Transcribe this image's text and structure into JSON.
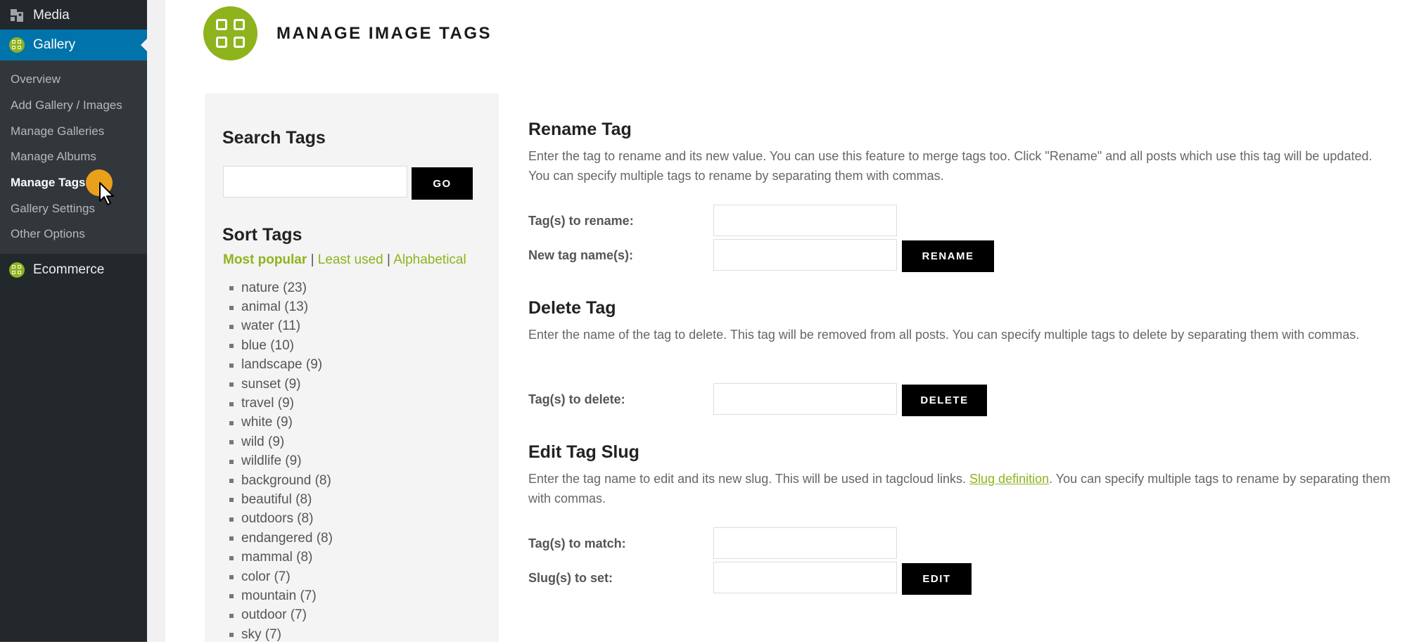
{
  "sidebar": {
    "media_label": "Media",
    "gallery_label": "Gallery",
    "submenu": [
      {
        "label": "Overview"
      },
      {
        "label": "Add Gallery / Images"
      },
      {
        "label": "Manage Galleries"
      },
      {
        "label": "Manage Albums"
      },
      {
        "label": "Manage Tags",
        "current": true
      },
      {
        "label": "Gallery Settings"
      },
      {
        "label": "Other Options"
      }
    ],
    "ecommerce_label": "Ecommerce",
    "colors": {
      "bg": "#23282d",
      "active": "#0073aa",
      "submenu_bg": "#32373c",
      "brand": "#8fb31d"
    }
  },
  "header": {
    "title": "MANAGE IMAGE TAGS",
    "icon": "grid-icon"
  },
  "search": {
    "heading": "Search Tags",
    "input_value": "",
    "button_label": "GO"
  },
  "sort": {
    "heading": "Sort Tags",
    "options": [
      "Most popular",
      "Least used",
      "Alphabetical"
    ],
    "active": "Most popular",
    "separator": "|"
  },
  "tags": [
    "nature (23)",
    "animal (13)",
    "water (11)",
    "blue (10)",
    "landscape (9)",
    "sunset (9)",
    "travel (9)",
    "white (9)",
    "wild (9)",
    "wildlife (9)",
    "background (8)",
    "beautiful (8)",
    "outdoors (8)",
    "endangered (8)",
    "mammal (8)",
    "color (7)",
    "mountain (7)",
    "outdoor (7)",
    "sky (7)"
  ],
  "rename": {
    "heading": "Rename Tag",
    "description": "Enter the tag to rename and its new value. You can use this feature to merge tags too. Click \"Rename\" and all posts which use this tag will be updated. You can specify multiple tags to rename by separating them with commas.",
    "label_from": "Tag(s) to rename:",
    "label_to": "New tag name(s):",
    "button_label": "RENAME"
  },
  "delete": {
    "heading": "Delete Tag",
    "description": "Enter the name of the tag to delete. This tag will be removed from all posts. You can specify multiple tags to delete by separating them with commas.",
    "label": "Tag(s) to delete:",
    "button_label": "DELETE"
  },
  "slug": {
    "heading": "Edit Tag Slug",
    "description_before": "Enter the tag name to edit and its new slug. This will be used in tagcloud links. ",
    "link_text": "Slug definition",
    "description_after": ". You can specify multiple tags to rename by separating them with commas.",
    "label_match": "Tag(s) to match:",
    "label_set": "Slug(s) to set:",
    "button_label": "EDIT"
  }
}
